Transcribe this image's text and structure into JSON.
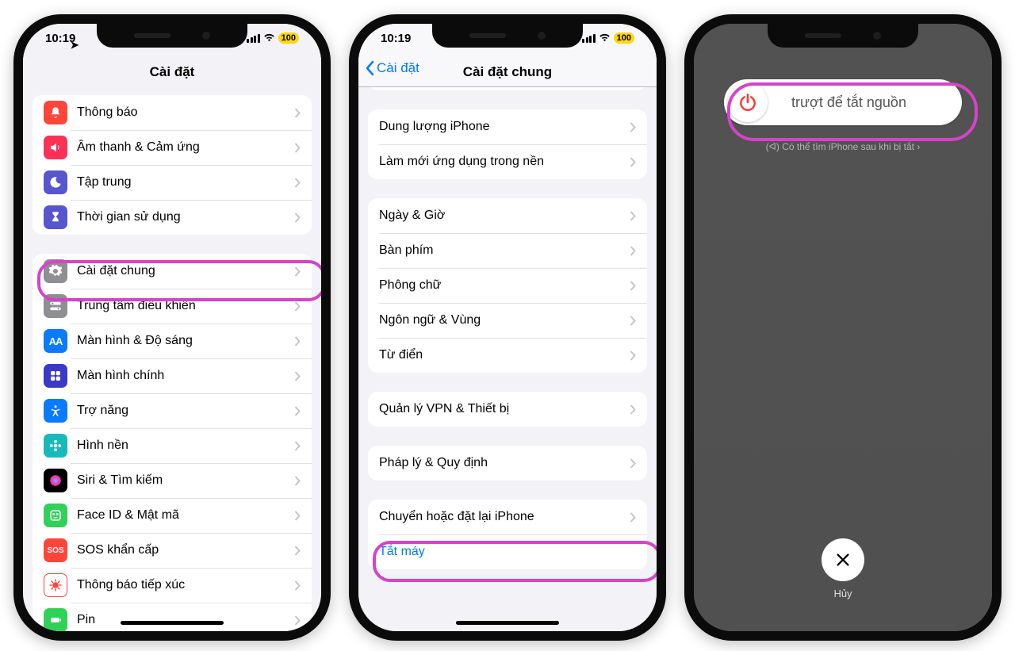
{
  "status": {
    "time": "10:19",
    "battery": "100"
  },
  "phone1": {
    "title": "Cài đặt",
    "group1": [
      {
        "label": "Thông báo",
        "color": "#fd453a",
        "icon": "bell"
      },
      {
        "label": "Âm thanh & Cảm ứng",
        "color": "#fc3158",
        "icon": "sound"
      },
      {
        "label": "Tập trung",
        "color": "#5756ce",
        "icon": "moon"
      },
      {
        "label": "Thời gian sử dụng",
        "color": "#5756ce",
        "icon": "hourglass"
      }
    ],
    "group2": [
      {
        "label": "Cài đặt chung",
        "color": "#8e8e93",
        "icon": "gear",
        "hl": true
      },
      {
        "label": "Trung tâm điều khiển",
        "color": "#8e8e93",
        "icon": "switches"
      },
      {
        "label": "Màn hình & Độ sáng",
        "color": "#0a7aff",
        "icon": "aa"
      },
      {
        "label": "Màn hình chính",
        "color": "#3a3ac9",
        "icon": "grid"
      },
      {
        "label": "Trợ năng",
        "color": "#0a7aff",
        "icon": "access"
      },
      {
        "label": "Hình nền",
        "color": "#18b8bb",
        "icon": "flower"
      },
      {
        "label": "Siri & Tìm kiếm",
        "color": "#000",
        "icon": "siri"
      },
      {
        "label": "Face ID & Mật mã",
        "color": "#30d158",
        "icon": "face"
      },
      {
        "label": "SOS khẩn cấp",
        "color": "#fd453a",
        "icon": "sos"
      },
      {
        "label": "Thông báo tiếp xúc",
        "color": "#fff",
        "icon": "covid",
        "fg": "#fd453a"
      },
      {
        "label": "Pin",
        "color": "#30d158",
        "icon": "batt"
      }
    ]
  },
  "phone2": {
    "title": "Cài đặt chung",
    "back": "Cài đặt",
    "group1": [
      "Dung lượng iPhone",
      "Làm mới ứng dụng trong nền"
    ],
    "group2": [
      "Ngày & Giờ",
      "Bàn phím",
      "Phông chữ",
      "Ngôn ngữ & Vùng",
      "Từ điển"
    ],
    "group3": [
      "Quản lý VPN & Thiết bị"
    ],
    "group4": [
      "Pháp lý & Quy định"
    ],
    "group5": [
      {
        "label": "Chuyển hoặc đặt lại iPhone"
      },
      {
        "label": "Tắt máy",
        "blue": true,
        "noarrow": true,
        "hl": true
      }
    ]
  },
  "phone3": {
    "slide": "trượt để tắt nguồn",
    "find": "(ᐊ) Có thể tìm iPhone sau khi bị tắt  ›",
    "cancel": "Hủy"
  }
}
